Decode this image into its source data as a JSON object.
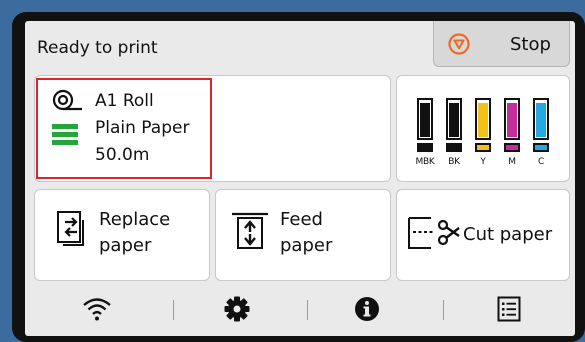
{
  "header": {
    "status": "Ready to print",
    "stop_label": "Stop"
  },
  "media": {
    "line1": "A1 Roll",
    "line2": "Plain Paper",
    "line3": "50.0m",
    "level_bars": 3
  },
  "inks": [
    {
      "code": "MBK",
      "color": "#111111",
      "level": 0.95
    },
    {
      "code": "BK",
      "color": "#111111",
      "level": 0.95
    },
    {
      "code": "Y",
      "color": "#f2c21a",
      "level": 0.95
    },
    {
      "code": "M",
      "color": "#c42e9c",
      "level": 0.95
    },
    {
      "code": "C",
      "color": "#23a9e0",
      "level": 0.95
    }
  ],
  "actions": {
    "replace": {
      "line1": "Replace",
      "line2": "paper"
    },
    "feed": {
      "line1": "Feed",
      "line2": "paper"
    },
    "cut": {
      "label": "Cut paper"
    }
  },
  "icons": {
    "stop": "stop-icon",
    "roll": "paper-roll-icon",
    "wifi": "wifi-icon",
    "settings": "gear-icon",
    "info": "info-icon",
    "list": "list-icon"
  },
  "colors": {
    "highlight": "#d9262c",
    "level_green": "#25a63a",
    "stop_orange": "#f26a21"
  }
}
